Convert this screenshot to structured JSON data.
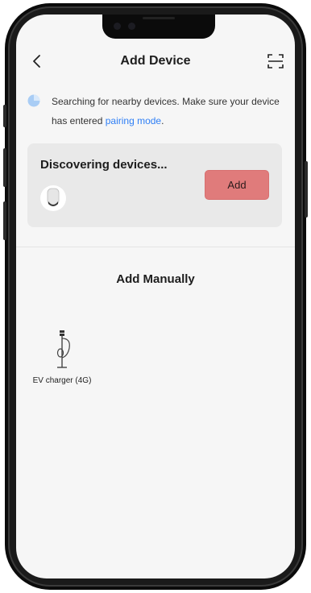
{
  "header": {
    "title": "Add Device",
    "back_icon": "chevron-left-icon",
    "scan_icon": "scan-frame-icon"
  },
  "hint": {
    "text_before": "Searching for nearby devices. Make sure your device has entered ",
    "link_text": "pairing mode",
    "text_after": "."
  },
  "discovery": {
    "title": "Discovering devices...",
    "add_label": "Add"
  },
  "manual": {
    "title": "Add Manually",
    "items": [
      {
        "label": "EV charger (4G)",
        "icon": "ev-charger-icon"
      }
    ]
  },
  "colors": {
    "accent_link": "#2f7ff5",
    "add_button": "#e07b7b",
    "card_bg": "#e9e9e9",
    "screen_bg": "#f6f6f6"
  }
}
